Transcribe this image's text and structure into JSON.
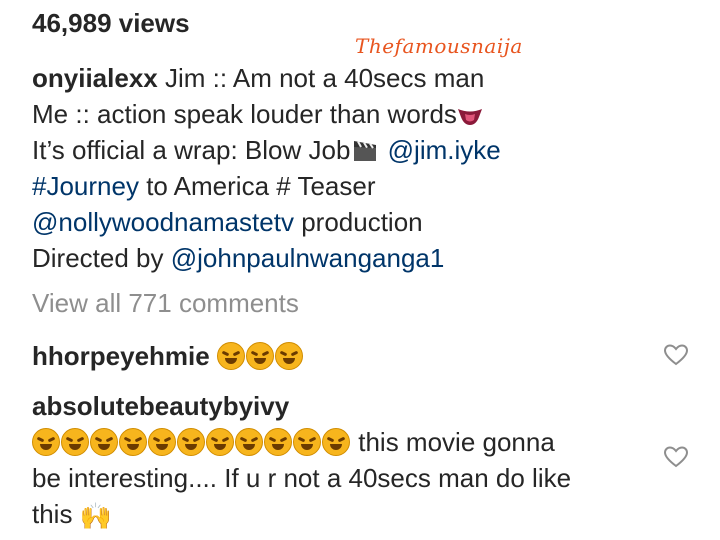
{
  "post": {
    "views": "46,989 views",
    "watermark": "Thefamousnaija",
    "author": "onyiialexx",
    "caption_line1": "Jim :: Am not a 40secs man",
    "caption_line2": "Me :: action speak louder than words",
    "caption_line3": "It’s official a wrap: Blow Job",
    "mention_jim": "@jim.iyke",
    "hashtag_journey": "#Journey",
    "caption_line4_rest": "to America # Teaser",
    "mention_nolly": "@nollywoodnamastetv",
    "caption_line5_rest": "production",
    "caption_line6_prefix": "Directed by",
    "mention_director": "@johnpaulnwanganga1",
    "view_all": "View all 771 comments"
  },
  "comments": [
    {
      "username": "hhorpeyehmie",
      "text": ""
    },
    {
      "username": "absolutebeautybyivy",
      "text_a": "this movie gonna",
      "text_b": "be interesting.... If u r not a 40secs man do like",
      "text_c": "this"
    }
  ],
  "icons": {
    "emoji": "rolling-laughing-emoji",
    "tongue": "tongue-emoji",
    "clapper": "clapper-board-emoji",
    "clap": "raised-hands-emoji",
    "heart": "heart-outline-icon"
  },
  "colors": {
    "link": "#003569",
    "muted": "#8e8e8e",
    "text": "#262626",
    "watermark": "#e8551f"
  }
}
